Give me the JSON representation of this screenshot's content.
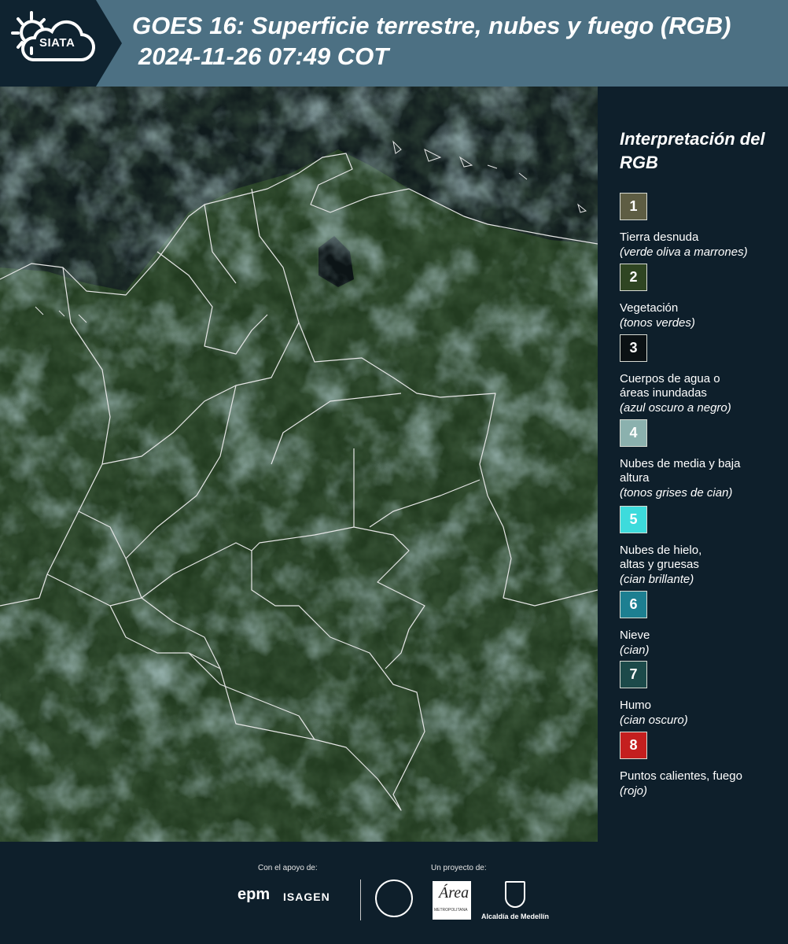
{
  "header": {
    "logo_text": "SIATA",
    "title": "GOES 16: Superficie terrestre, nubes y fuego (RGB)",
    "subtitle": "2024-11-26 07:49 COT"
  },
  "legend": {
    "title": "Interpretación del RGB",
    "items": [
      {
        "number": "1",
        "label": "Tierra desnuda",
        "desc": "(verde oliva a marrones)",
        "color": "#5e5d43"
      },
      {
        "number": "2",
        "label": "Vegetación",
        "desc": "(tonos verdes)",
        "color": "#2f4522"
      },
      {
        "number": "3",
        "label": "Cuerpos de agua o áreas inundadas",
        "desc": "(azul oscuro a negro)",
        "color": "#0b1114"
      },
      {
        "number": "4",
        "label": "Nubes de media y baja altura",
        "desc": "(tonos grises de cian)",
        "color": "#8bb1ae"
      },
      {
        "number": "5",
        "label": "Nubes de hielo, altas y gruesas",
        "desc": "(cian brillante)",
        "color": "#3ddbdc"
      },
      {
        "number": "6",
        "label": "Nieve",
        "desc": "(cian)",
        "color": "#1d7f91"
      },
      {
        "number": "7",
        "label": "Humo",
        "desc": "(cian oscuro)",
        "color": "#1c4a4a"
      },
      {
        "number": "8",
        "label": "Puntos calientes, fuego",
        "desc": "(rojo)",
        "color": "#c41f1f"
      }
    ]
  },
  "footer": {
    "support_label": "Con el apoyo de:",
    "project_label": "Un proyecto de:",
    "sponsors": [
      "epm",
      "ISAGEN"
    ],
    "partners": [
      "Área Metropolitana Valle de Aburrá",
      "Alcaldía de Medellín"
    ],
    "epm_text": "epm",
    "isagen_text": "ISAGEN",
    "area_text": "Área",
    "area_sub": "METROPOLITANA",
    "alcaldia_text": "Alcaldía de Medellín"
  },
  "map": {
    "colors": {
      "sea": "#0f1a1c",
      "land": "#213a1f",
      "cloud": "#6f9ea2",
      "border": "#e6e6e6"
    }
  }
}
